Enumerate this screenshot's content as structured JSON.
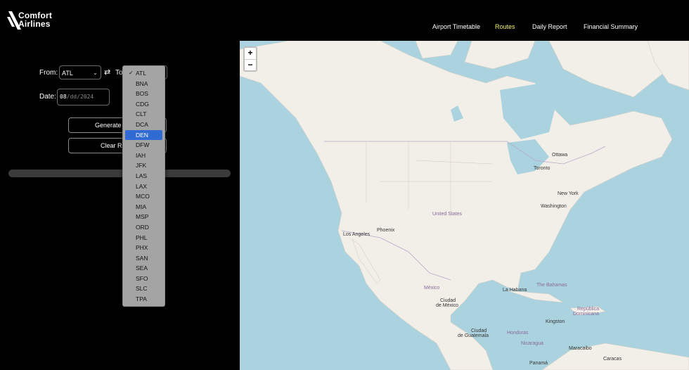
{
  "brand": {
    "line1": "Comfort",
    "line2": "Airlines"
  },
  "nav": [
    {
      "label": "Airport Timetable",
      "active": false
    },
    {
      "label": "Routes",
      "active": true
    },
    {
      "label": "Daily Report",
      "active": false
    },
    {
      "label": "Financial Summary",
      "active": false
    }
  ],
  "form": {
    "from_label": "From:",
    "from_value": "ATL",
    "swap_icon": "swap-icon",
    "to_label": "To",
    "date_label": "Date:",
    "date_value_month": "08",
    "date_value_day": "dd",
    "date_value_year": "2024",
    "generate_button": "Generate Route",
    "clear_button": "Clear Route"
  },
  "dropdown": {
    "checked": "ATL",
    "highlighted": "DEN",
    "options": [
      "ATL",
      "BNA",
      "BOS",
      "CDG",
      "CLT",
      "DCA",
      "DEN",
      "DFW",
      "IAH",
      "JFK",
      "LAS",
      "LAX",
      "MCO",
      "MIA",
      "MSP",
      "ORD",
      "PHL",
      "PHX",
      "SAN",
      "SEA",
      "SFO",
      "SLC",
      "TPA"
    ]
  },
  "map": {
    "zoom_in": "+",
    "zoom_out": "−",
    "labels": {
      "ottawa": "Ottawa",
      "toronto": "Toronto",
      "new_york": "New York",
      "washington": "Washington",
      "united_states": "United States",
      "los_angeles": "Los Angeles",
      "phoenix": "Phoenix",
      "mexico": "México",
      "la_habana": "La Habana",
      "the_bahamas": "The Bahamas",
      "ciudad_de_mexico_1": "Ciudad",
      "ciudad_de_mexico_2": "de México",
      "republica_1": "República",
      "republica_2": "Dominicana",
      "kingston": "Kingston",
      "ciudad_guatemala_1": "Ciudad",
      "ciudad_guatemala_2": "de Guatemala",
      "honduras": "Honduras",
      "nicaragua": "Nicaragua",
      "maracaibo": "Maracaibo",
      "caracas": "Caracas",
      "panama": "Panamá"
    },
    "colors": {
      "water": "#aad3df",
      "land": "#f2efe9",
      "border": "#b9a8c9"
    }
  }
}
